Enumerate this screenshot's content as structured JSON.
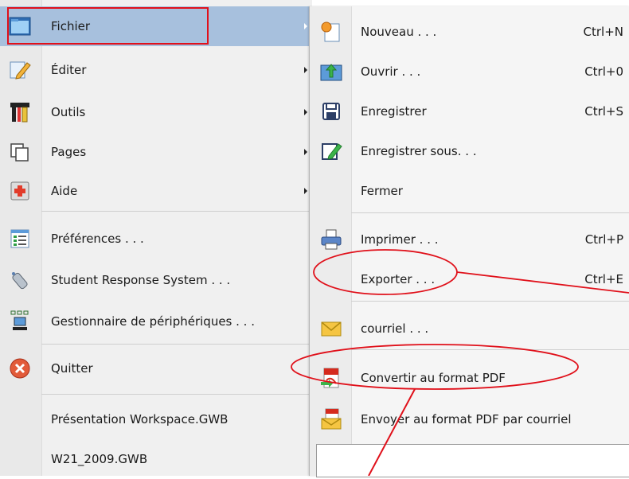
{
  "main_menu": {
    "items": [
      {
        "label": "Fichier",
        "icon": "folder-icon",
        "has_submenu": true,
        "active": true
      },
      {
        "label": "Éditer",
        "icon": "edit-icon",
        "has_submenu": true
      },
      {
        "label": "Outils",
        "icon": "tools-icon",
        "has_submenu": true
      },
      {
        "label": "Pages",
        "icon": "pages-icon",
        "has_submenu": true
      },
      {
        "label": "Aide",
        "icon": "help-icon",
        "has_submenu": true
      },
      {
        "label": "Préférences . . .",
        "icon": "preferences-icon"
      },
      {
        "label": "Student Response System . . .",
        "icon": "remote-icon"
      },
      {
        "label": "Gestionnaire de périphériques . . .",
        "icon": "device-manager-icon"
      },
      {
        "label": "Quitter",
        "icon": "quit-icon"
      },
      {
        "label": "Présentation Workspace.GWB"
      },
      {
        "label": "W21_2009.GWB"
      }
    ]
  },
  "file_submenu": {
    "items": [
      {
        "label": "Nouveau . . .",
        "shortcut": "Ctrl+N",
        "icon": "new-file-icon"
      },
      {
        "label": "Ouvrir . . .",
        "shortcut": "Ctrl+0",
        "icon": "open-folder-icon"
      },
      {
        "label": "Enregistrer",
        "shortcut": "Ctrl+S",
        "icon": "save-icon"
      },
      {
        "label": "Enregistrer sous. . .",
        "icon": "save-as-icon"
      },
      {
        "label": "Fermer"
      },
      {
        "label": "Imprimer . . .",
        "shortcut": "Ctrl+P",
        "icon": "printer-icon"
      },
      {
        "label": "Exporter . . .",
        "shortcut": "Ctrl+E"
      },
      {
        "label": "courriel . . .",
        "icon": "email-icon"
      },
      {
        "label": "Convertir au format PDF",
        "icon": "pdf-icon"
      },
      {
        "label": "Envoyer au format PDF par courriel",
        "icon": "pdf-email-icon"
      }
    ]
  },
  "annotation_color": "#e0101a"
}
